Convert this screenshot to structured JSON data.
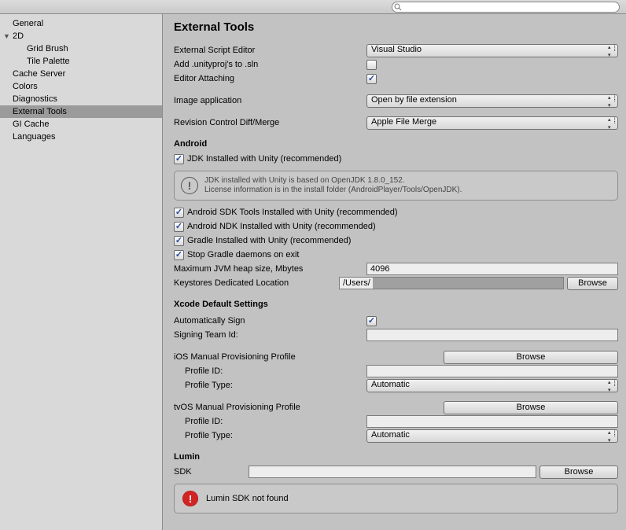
{
  "sidebar": {
    "items": [
      {
        "label": "General"
      },
      {
        "label": "2D",
        "expanded": true
      },
      {
        "label": "Grid Brush",
        "child": true
      },
      {
        "label": "Tile Palette",
        "child": true
      },
      {
        "label": "Cache Server"
      },
      {
        "label": "Colors"
      },
      {
        "label": "Diagnostics"
      },
      {
        "label": "External Tools",
        "selected": true
      },
      {
        "label": "GI Cache"
      },
      {
        "label": "Languages"
      }
    ]
  },
  "page": {
    "title": "External Tools",
    "external_editor_lbl": "External Script Editor",
    "external_editor_val": "Visual Studio",
    "add_sln_lbl": "Add .unityproj's to .sln",
    "editor_attach_lbl": "Editor Attaching",
    "image_app_lbl": "Image application",
    "image_app_val": "Open by file extension",
    "rev_ctrl_lbl": "Revision Control Diff/Merge",
    "rev_ctrl_val": "Apple File Merge",
    "android_hdr": "Android",
    "jdk_lbl": "JDK Installed with Unity (recommended)",
    "jdk_info1": "JDK installed with Unity is based on OpenJDK 1.8.0_152.",
    "jdk_info2": "License information is in the install folder (AndroidPlayer/Tools/OpenJDK).",
    "sdk_tools_lbl": "Android SDK Tools Installed with Unity (recommended)",
    "ndk_lbl": "Android NDK Installed with Unity (recommended)",
    "gradle_lbl": "Gradle Installed with Unity (recommended)",
    "stop_gradle_lbl": "Stop Gradle daemons on exit",
    "jvm_heap_lbl": "Maximum JVM heap size, Mbytes",
    "jvm_heap_val": "4096",
    "keystore_lbl": "Keystores Dedicated Location",
    "keystore_val": "/Users/",
    "browse_lbl": "Browse",
    "xcode_hdr": "Xcode Default Settings",
    "auto_sign_lbl": "Automatically Sign",
    "team_id_lbl": "Signing Team Id:",
    "ios_prov_lbl": "iOS Manual Provisioning Profile",
    "profile_id_lbl": "Profile ID:",
    "profile_type_lbl": "Profile Type:",
    "profile_type_val": "Automatic",
    "tvos_prov_lbl": "tvOS Manual Provisioning Profile",
    "lumin_hdr": "Lumin",
    "lumin_sdk_lbl": "SDK",
    "lumin_err": "Lumin SDK not found"
  }
}
